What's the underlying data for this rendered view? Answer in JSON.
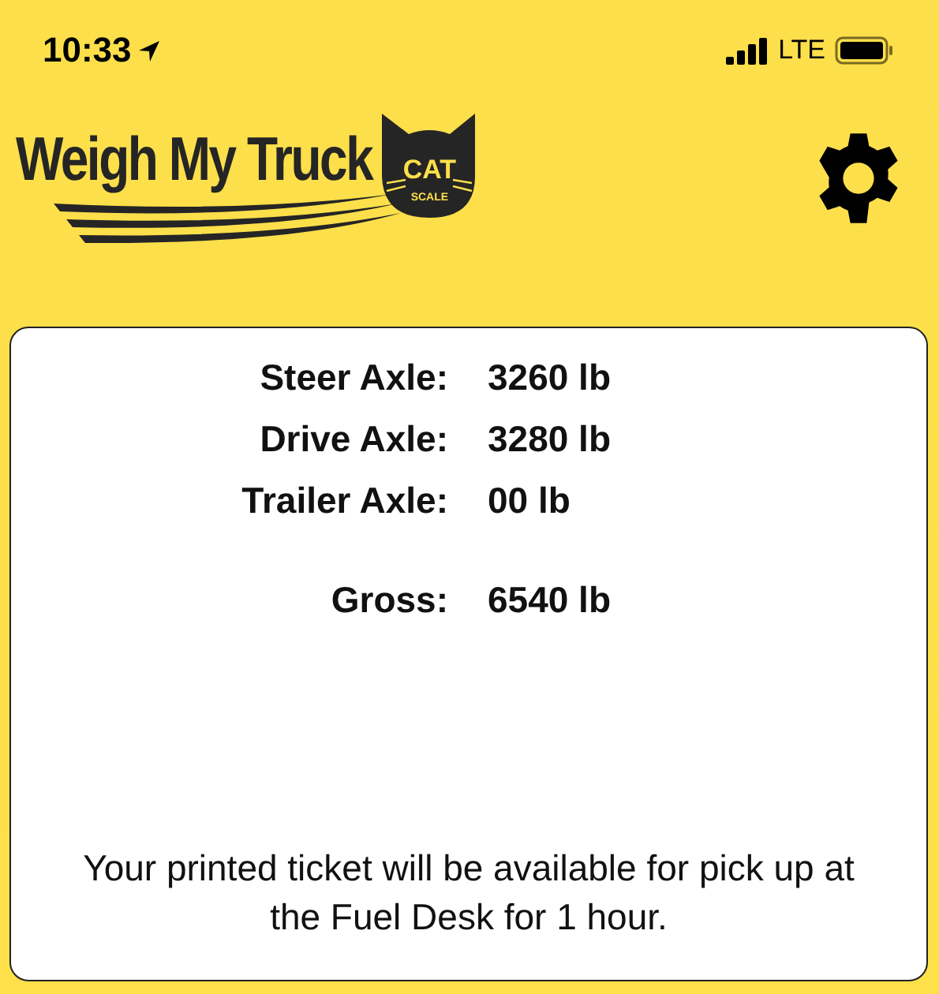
{
  "status_bar": {
    "time": "10:33",
    "network": "LTE"
  },
  "header": {
    "logo": {
      "title": "Weigh My Truck",
      "badge_top": "CAT",
      "badge_bottom": "SCALE"
    }
  },
  "weights": [
    {
      "label": "Steer Axle:",
      "value": "3260 lb"
    },
    {
      "label": "Drive Axle:",
      "value": "3280 lb"
    },
    {
      "label": "Trailer Axle:",
      "value": "00 lb"
    }
  ],
  "gross": {
    "label": "Gross:",
    "value": "6540 lb"
  },
  "notice": "Your printed ticket will be available for pick up at the Fuel Desk for 1 hour."
}
